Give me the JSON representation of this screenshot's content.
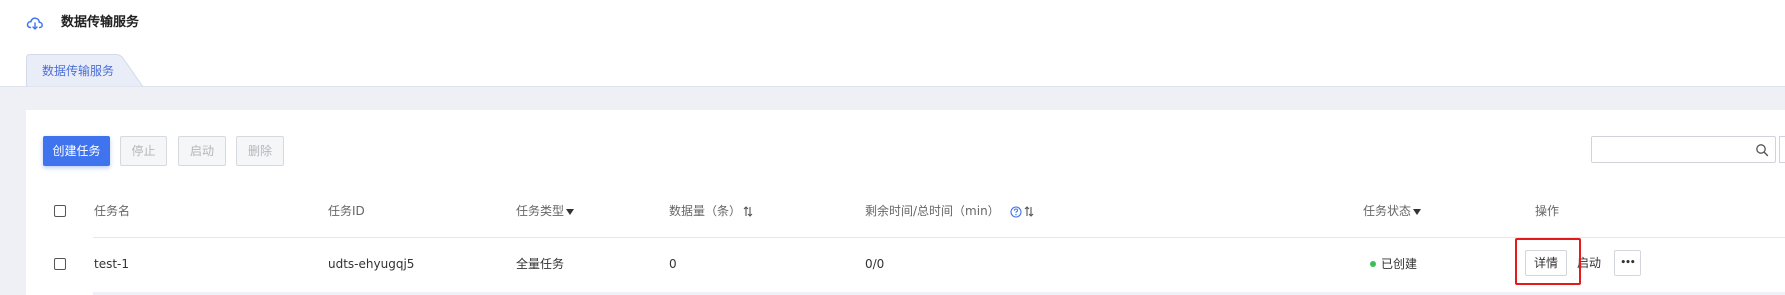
{
  "app": {
    "title": "数据传输服务",
    "icon": "cloud-sync-icon"
  },
  "tabs": [
    {
      "label": "数据传输服务",
      "active": true
    }
  ],
  "toolbar": {
    "create_label": "创建任务",
    "stop_label": "停止",
    "start_label": "启动",
    "delete_label": "删除",
    "search_placeholder": "",
    "search_icon": "search-icon"
  },
  "table": {
    "headers": {
      "name": "任务名",
      "id": "任务ID",
      "type": "任务类型",
      "volume": "数据量（条）",
      "time": "剩余时间/总时间（min）",
      "status": "任务状态",
      "actions": "操作"
    },
    "rows": [
      {
        "name": "test-1",
        "id": "udts-ehyugqj5",
        "type": "全量任务",
        "volume": "0",
        "time": "0/0",
        "status": "已创建",
        "status_color": "#3bbf5a",
        "actions": {
          "detail": "详情",
          "start": "启动",
          "more": "•••"
        }
      }
    ]
  },
  "colors": {
    "primary": "#3f74ee",
    "tab_text": "#4a6ed8",
    "highlight": "#e21a1a"
  }
}
